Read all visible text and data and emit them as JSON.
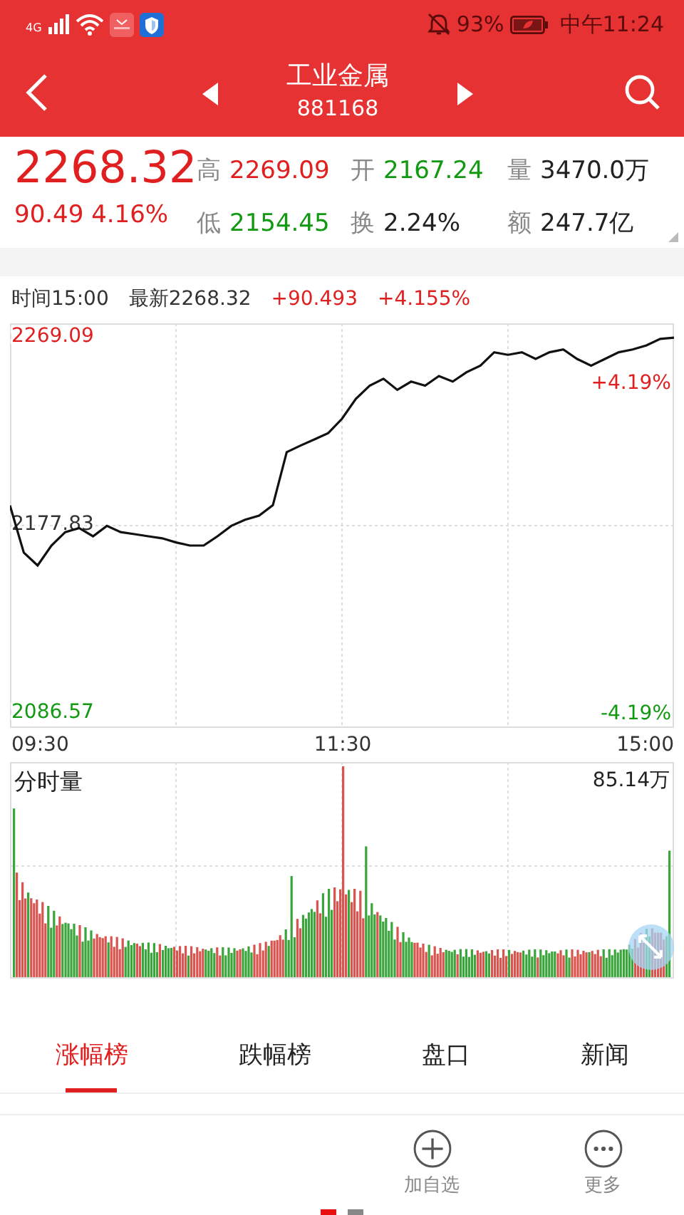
{
  "status_bar": {
    "network": "4G",
    "battery": "93%",
    "time": "中午11:24"
  },
  "header": {
    "title": "工业金属",
    "code": "881168"
  },
  "quote": {
    "price": "2268.32",
    "change": "90.49 4.16%",
    "stats": [
      {
        "label": "高",
        "value": "2269.09",
        "color": "#e02020"
      },
      {
        "label": "开",
        "value": "2167.24",
        "color": "#119911"
      },
      {
        "label": "量",
        "value": "3470.0万",
        "color": "#222222"
      },
      {
        "label": "低",
        "value": "2154.45",
        "color": "#119911"
      },
      {
        "label": "换",
        "value": "2.24%",
        "color": "#222222"
      },
      {
        "label": "额",
        "value": "247.7亿",
        "color": "#222222"
      }
    ]
  },
  "info_line": [
    {
      "text": "时间15:00",
      "color": "#333333"
    },
    {
      "text": "最新2268.32",
      "color": "#333333"
    },
    {
      "text": "+90.493",
      "color": "#e02020"
    },
    {
      "text": "+4.155%",
      "color": "#e02020"
    }
  ],
  "price_chart": {
    "pct_high": "+4.19%",
    "pct_low": "-4.19%",
    "time_labels": [
      "09:30",
      "11:30",
      "15:00"
    ],
    "chart_data": {
      "type": "line",
      "grid": true,
      "ylim": [
        2079.0,
        2275.3
      ],
      "yticks": [
        {
          "value": 2269.09,
          "label": "2269.09"
        },
        {
          "value": 2177.83,
          "label": "2177.83"
        },
        {
          "value": 2086.57,
          "label": "2086.57"
        }
      ],
      "series": [
        {
          "color": "#111111",
          "values": [
            2186.9,
            2164,
            2157.8,
            2167.5,
            2174,
            2176,
            2172,
            2177,
            2174,
            2173,
            2172,
            2171,
            2169,
            2167.5,
            2167.5,
            2172,
            2177,
            2180,
            2182,
            2187,
            2212.8,
            2216,
            2219,
            2222,
            2229,
            2238.7,
            2245,
            2248.4,
            2243,
            2247,
            2245,
            2249.7,
            2247,
            2251.6,
            2254.8,
            2261.3,
            2260,
            2261.3,
            2258,
            2261.3,
            2262.6,
            2258,
            2254.8,
            2258,
            2261.3,
            2262.6,
            2264.6,
            2267.8,
            2268.3
          ]
        }
      ]
    }
  },
  "volume_chart": {
    "title": "分时量",
    "max": "85.14万"
  },
  "tabs": [
    {
      "label": "涨幅榜",
      "selected": true
    },
    {
      "label": "跌幅榜",
      "selected": false
    },
    {
      "label": "盘口",
      "selected": false
    },
    {
      "label": "新闻",
      "selected": false
    }
  ],
  "actions": [
    {
      "label": "加自选",
      "kind": "add"
    },
    {
      "label": "更多",
      "kind": "more"
    }
  ],
  "pages": [
    {
      "selected": true
    },
    {
      "selected": false
    }
  ]
}
